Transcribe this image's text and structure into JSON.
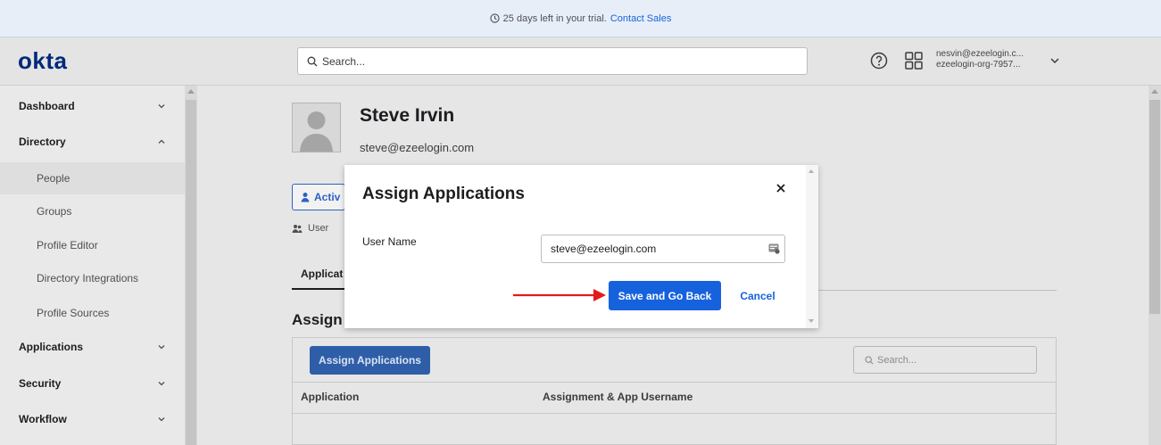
{
  "banner": {
    "message": "25 days left in your trial.",
    "link": "Contact Sales"
  },
  "header": {
    "logo": "okta",
    "search_placeholder": "Search...",
    "user_email": "nesvin@ezeelogin.c...",
    "user_org": "ezeelogin-org-7957..."
  },
  "sidebar": {
    "items": [
      {
        "label": "Dashboard",
        "expanded": false
      },
      {
        "label": "Directory",
        "expanded": true
      },
      {
        "label": "People",
        "active": true
      },
      {
        "label": "Groups"
      },
      {
        "label": "Profile Editor"
      },
      {
        "label": "Directory Integrations"
      },
      {
        "label": "Profile Sources"
      },
      {
        "label": "Applications",
        "expanded": false
      },
      {
        "label": "Security",
        "expanded": false
      },
      {
        "label": "Workflow",
        "expanded": false
      }
    ]
  },
  "profile": {
    "name": "Steve Irvin",
    "email": "steve@ezeelogin.com",
    "activate_label": "Activ",
    "user_type": "User"
  },
  "tabs": {
    "applications": "Applicat"
  },
  "section": {
    "title": "Assign",
    "assign_button": "Assign Applications",
    "search_placeholder": "Search...",
    "columns": [
      "Application",
      "Assignment & App Username"
    ]
  },
  "modal": {
    "title": "Assign Applications",
    "field_label": "User Name",
    "field_value": "steve@ezeelogin.com",
    "save_label": "Save and Go Back",
    "cancel_label": "Cancel"
  },
  "colors": {
    "primary": "#1662dd",
    "logo": "#00297a",
    "annotation_arrow": "#e31b1b"
  }
}
